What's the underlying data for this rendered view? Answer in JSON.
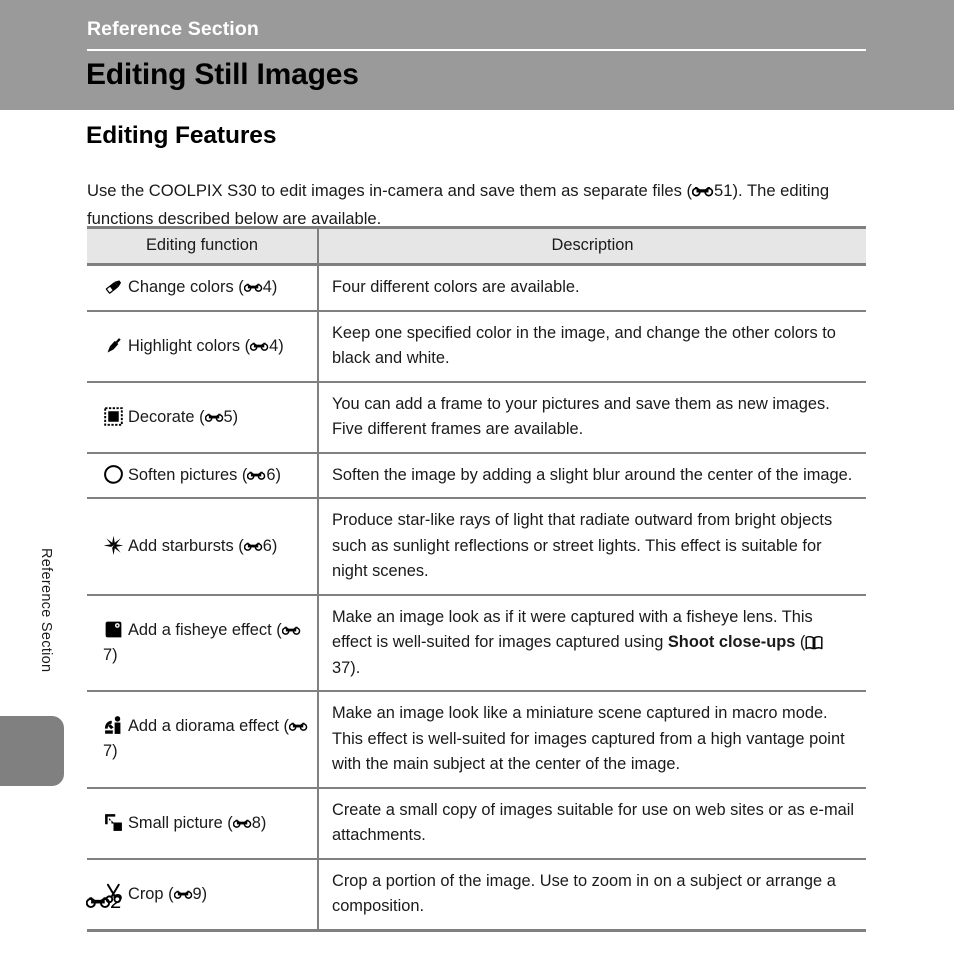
{
  "header": {
    "eyebrow": "Reference Section",
    "title": "Editing Still Images"
  },
  "side": {
    "label": "Reference Section"
  },
  "section": {
    "heading": "Editing Features",
    "intro_before": "Use the COOLPIX S30 to edit images in-camera and save them as separate files (",
    "intro_ref": "51",
    "intro_after": "). The editing functions described below are available."
  },
  "table": {
    "headers": {
      "function": "Editing function",
      "description": "Description"
    },
    "rows": [
      {
        "icon": "marker-icon",
        "name": "Change colors",
        "ref": "4",
        "desc_parts": [
          {
            "type": "text",
            "value": "Four different colors are available."
          }
        ]
      },
      {
        "icon": "pen-icon",
        "name": "Highlight colors",
        "ref": "4",
        "desc_parts": [
          {
            "type": "text",
            "value": "Keep one specified color in the image, and change the other colors to black and white."
          }
        ]
      },
      {
        "icon": "frame-icon",
        "name": "Decorate",
        "ref": "5",
        "desc_parts": [
          {
            "type": "text",
            "value": "You can add a frame to your pictures and save them as new images. Five different frames are available."
          }
        ]
      },
      {
        "icon": "blob-icon",
        "name": "Soften pictures",
        "ref": "6",
        "desc_parts": [
          {
            "type": "text",
            "value": "Soften the image by adding a slight blur around the center of the image."
          }
        ]
      },
      {
        "icon": "starburst-icon",
        "name": "Add starbursts",
        "ref": "6",
        "desc_parts": [
          {
            "type": "text",
            "value": "Produce star-like rays of light that radiate outward from bright objects such as sunlight reflections or street lights. This effect is suitable for night scenes."
          }
        ]
      },
      {
        "icon": "fisheye-icon",
        "name": "Add a fisheye effect",
        "ref": "7",
        "desc_parts": [
          {
            "type": "text",
            "value": "Make an image look as if it were captured with a fisheye lens. This effect is well-suited for images captured using "
          },
          {
            "type": "bold",
            "value": "Shoot close-ups"
          },
          {
            "type": "text",
            "value": " ("
          },
          {
            "type": "book-ref",
            "value": "37"
          },
          {
            "type": "text",
            "value": ")."
          }
        ]
      },
      {
        "icon": "diorama-icon",
        "name": "Add a diorama effect",
        "ref": "7",
        "desc_parts": [
          {
            "type": "text",
            "value": "Make an image look like a miniature scene captured in macro mode. This effect is well-suited for images captured from a high vantage point with the main subject at the center of the image."
          }
        ]
      },
      {
        "icon": "small-picture-icon",
        "name": "Small picture",
        "ref": "8",
        "desc_parts": [
          {
            "type": "text",
            "value": "Create a small copy of images suitable for use on web sites or as e-mail attachments."
          }
        ]
      },
      {
        "icon": "scissors-icon",
        "name": "Crop",
        "ref": "9",
        "desc_parts": [
          {
            "type": "text",
            "value": "Crop a portion of the image. Use to zoom in on a subject or arrange a composition."
          }
        ]
      }
    ]
  },
  "footer": {
    "page_number": "2"
  },
  "colors": {
    "header_band": "#9a9a9a",
    "tab": "#808080",
    "table_header_fill": "#e6e6e6",
    "rule": "#808080",
    "text": "#1a1a1a"
  }
}
